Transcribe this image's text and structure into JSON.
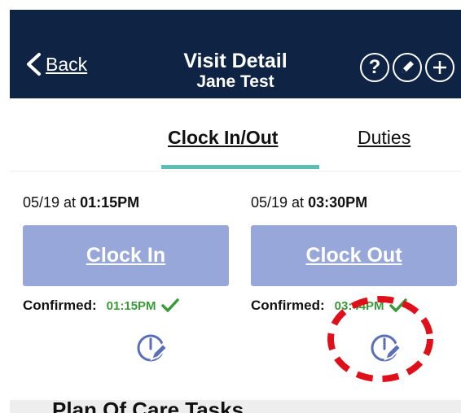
{
  "header": {
    "back_label": "Back",
    "title": "Visit Detail",
    "subtitle": "Jane Test",
    "icons": [
      "help-icon",
      "pencil-icon",
      "plus-icon"
    ],
    "help_glyph": "?",
    "background": "#0f2444"
  },
  "tabs": [
    {
      "label": "Clock In/Out",
      "active": true
    },
    {
      "label": "Duties",
      "active": false
    }
  ],
  "tab_indicator_color": "#5cbfb6",
  "clock_in": {
    "date": "05/19 at ",
    "time": "01:15PM",
    "button_label": "Clock In",
    "confirmed_label": "Confirmed:",
    "confirmed_time": "01:15PM"
  },
  "clock_out": {
    "date": "05/19 at ",
    "time": "03:30PM",
    "button_label": "Clock Out",
    "confirmed_label": "Confirmed:",
    "confirmed_time": "03:44PM"
  },
  "colors": {
    "button": "#98a7d9",
    "confirmed": "#3a9a3a",
    "edit_icon": "#5b6fb6",
    "annotation": "#e0101b"
  },
  "bottom_strip_text": "Plan Of Care Tasks"
}
